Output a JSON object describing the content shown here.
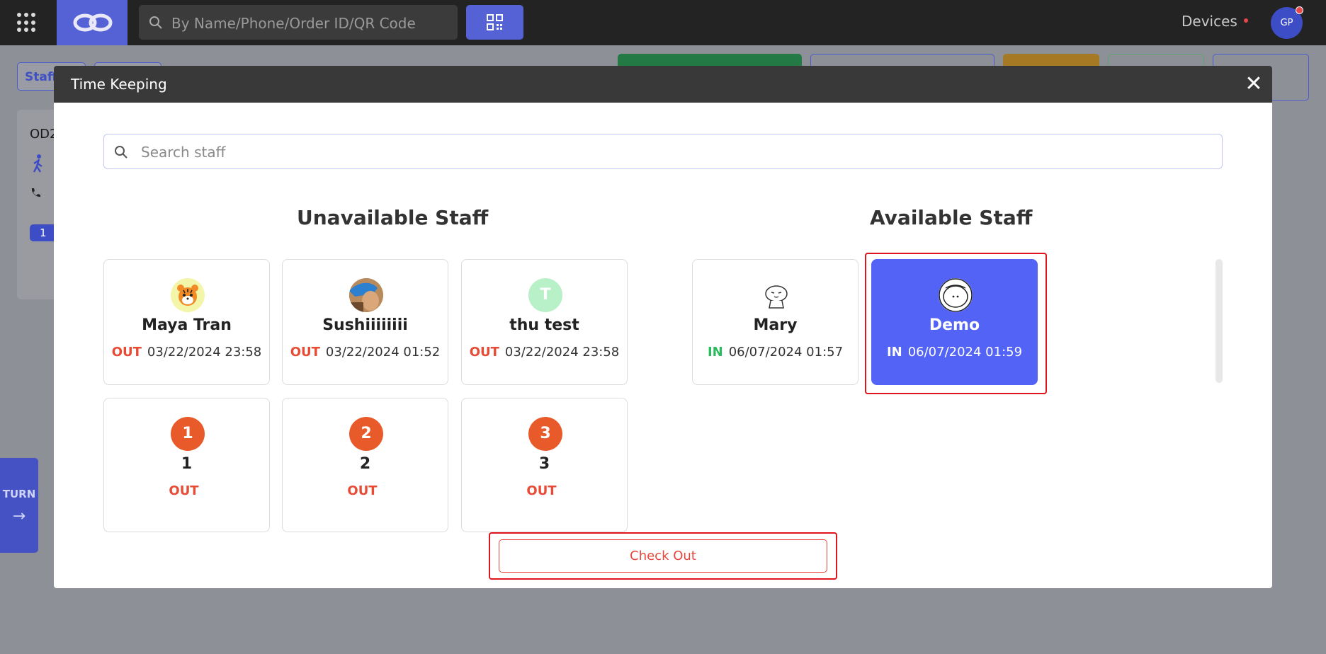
{
  "topbar": {
    "search_placeholder": "By Name/Phone/Order ID/QR Code",
    "devices_label": "Devices",
    "avatar_initials": "GP",
    "icons": [
      "apps-grid-icon",
      "logo-icon",
      "search-icon",
      "qr-code-icon"
    ]
  },
  "background": {
    "tab_label": "Staff",
    "card_id_text": "OD2",
    "card_badge": "1",
    "turn_label": "TURN",
    "turn_arrow": "→"
  },
  "modal": {
    "title": "Time Keeping",
    "close_label": "✕",
    "search_placeholder": "Search staff",
    "unavailable_title": "Unavailable Staff",
    "available_title": "Available Staff",
    "checkout_label": "Check Out"
  },
  "unavailable_staff": [
    {
      "name": "Maya Tran",
      "status": "OUT",
      "time": "03/22/2024 23:58",
      "avatar": "tiger-avatar"
    },
    {
      "name": "Sushiiiiiiii",
      "status": "OUT",
      "time": "03/22/2024 01:52",
      "avatar": "photo-avatar"
    },
    {
      "name": "thu test",
      "status": "OUT",
      "time": "03/22/2024 23:58",
      "avatar_letter": "T"
    },
    {
      "name": "1",
      "status": "OUT",
      "avatar_number": "1"
    },
    {
      "name": "2",
      "status": "OUT",
      "avatar_number": "2"
    },
    {
      "name": "3",
      "status": "OUT",
      "avatar_number": "3"
    }
  ],
  "available_staff": [
    {
      "name": "Mary",
      "status": "IN",
      "time": "06/07/2024 01:57",
      "avatar": "cartoon-avatar"
    },
    {
      "name": "Demo",
      "status": "IN",
      "time": "06/07/2024 01:59",
      "avatar": "cartoon-face-avatar",
      "selected": true
    }
  ],
  "colors": {
    "accent": "#5462d6",
    "selected_card": "#5263f5",
    "out": "#e84b35",
    "in": "#2bbb5f",
    "highlight": "#e0141c"
  }
}
